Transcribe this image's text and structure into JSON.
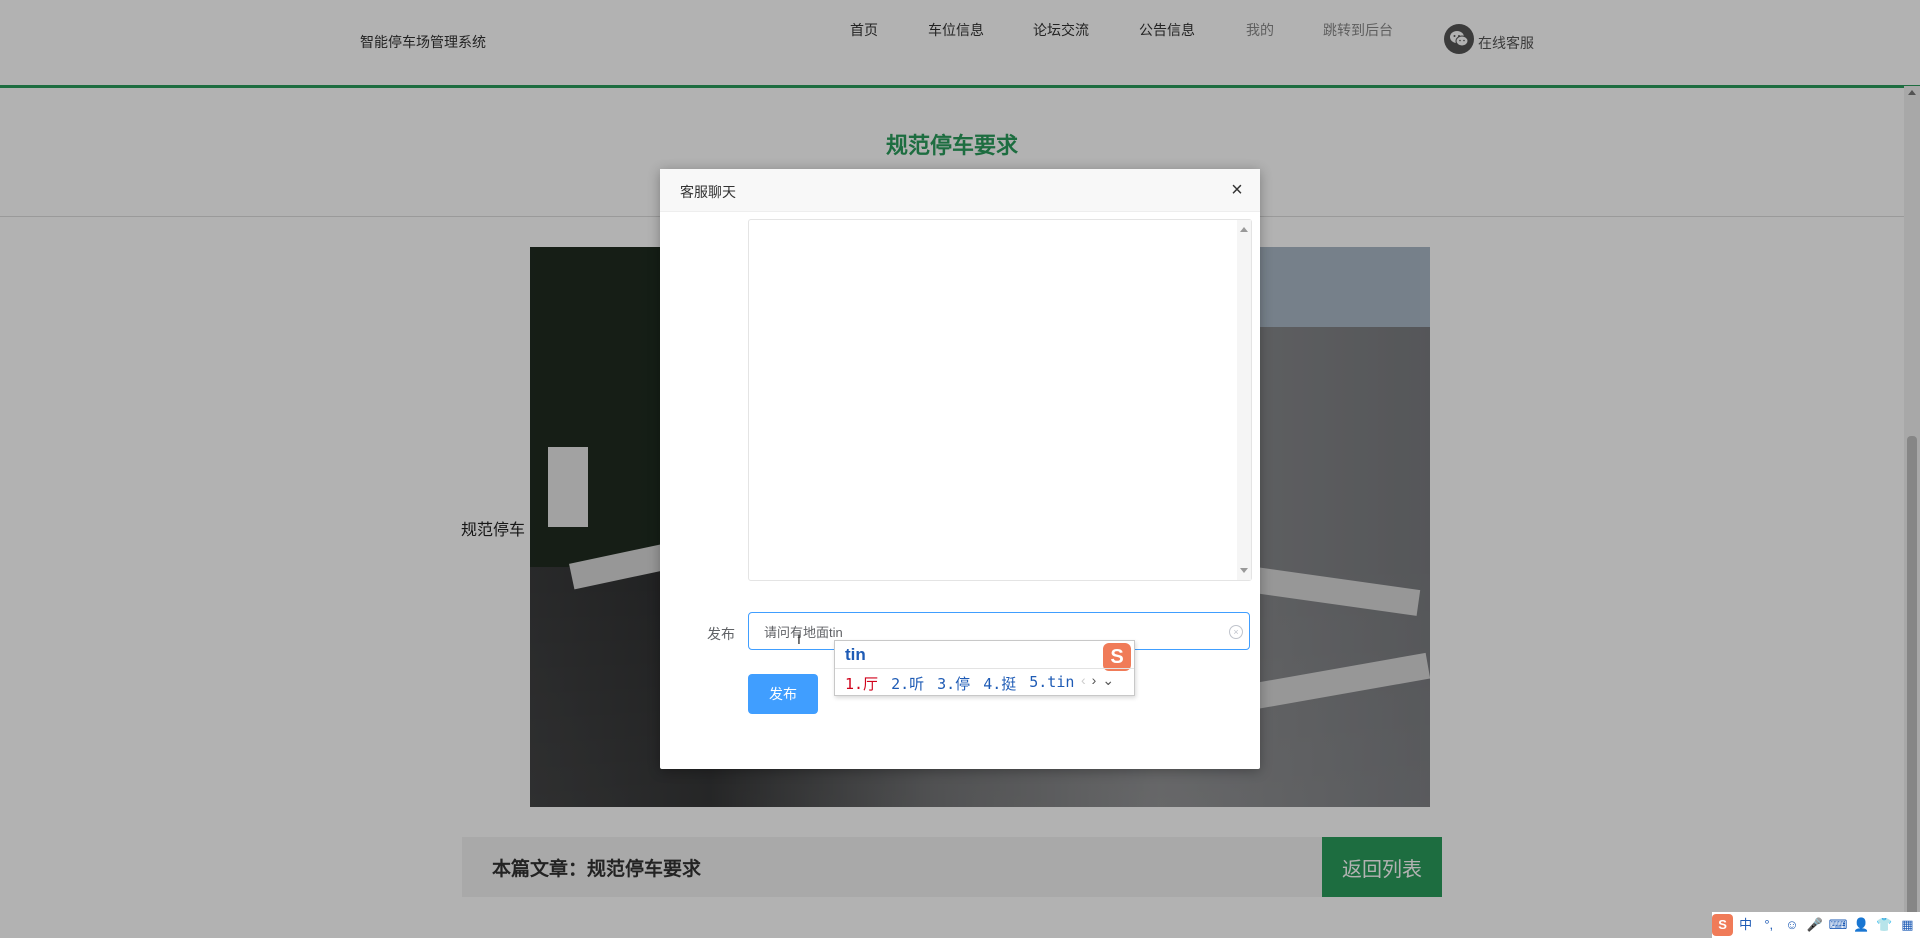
{
  "header": {
    "brand": "智能停车场管理系统",
    "nav": [
      {
        "label": "首页"
      },
      {
        "label": "车位信息"
      },
      {
        "label": "论坛交流"
      },
      {
        "label": "公告信息"
      },
      {
        "label": "我的"
      },
      {
        "label": "跳转到后台"
      }
    ],
    "chat_link": "在线客服"
  },
  "article": {
    "title": "规范停车要求",
    "photo_label": "规范停车",
    "current_prefix": "本篇文章：",
    "current_title": "规范停车要求",
    "back_label": "返回列表"
  },
  "modal": {
    "title": "客服聊天",
    "close": "×",
    "publish_label": "发布",
    "input_value": "请问有地面tin",
    "publish_button": "发布"
  },
  "ime": {
    "composition": "tin",
    "logo": "S",
    "candidates": [
      "1.厅",
      "2.听",
      "3.停",
      "4.挺",
      "5.tin"
    ],
    "prev": "‹",
    "next": "›",
    "expand": "⌄"
  },
  "tray": {
    "logo": "S",
    "items": [
      "中",
      "°,",
      "☺",
      "🎤",
      "⌨",
      "👤",
      "👕",
      "▦"
    ]
  },
  "colors": {
    "accent_green": "#2a9d5c",
    "primary_blue": "#409eff",
    "ime_blue": "#1e5bb5",
    "ime_red": "#d0021b"
  }
}
